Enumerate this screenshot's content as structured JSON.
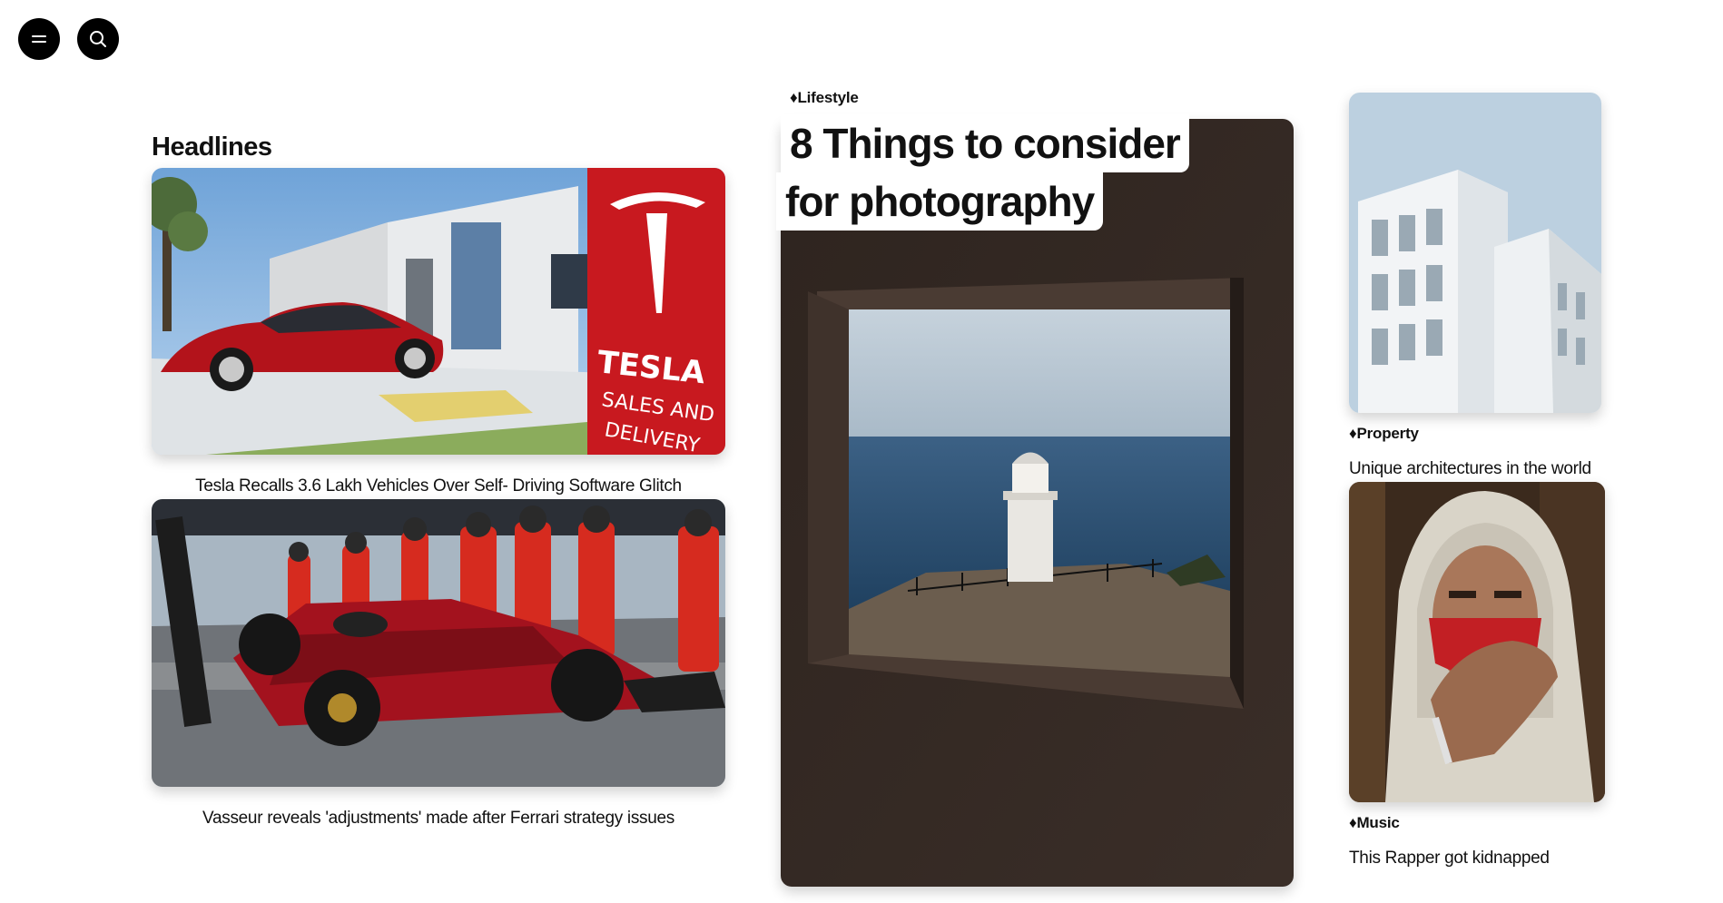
{
  "nav": {
    "menu_icon": "hamburger-menu-icon",
    "search_icon": "search-icon"
  },
  "headlines": {
    "title": "Headlines",
    "items": [
      {
        "caption": "Tesla Recalls 3.6 Lakh Vehicles Over Self- Driving Software Glitch",
        "image": "Red Tesla car parked in front of a Tesla sales and delivery building"
      },
      {
        "caption": "Vasseur reveals 'adjustments' made after Ferrari strategy issues",
        "image": "Ferrari Formula 1 car during a pit stop with crew in red suits"
      }
    ]
  },
  "feature": {
    "tag": "♦Lifestyle",
    "title_line1": "8 Things to consider",
    "title_line2": "for photography",
    "image": "Lighthouse by the sea seen through a stone window"
  },
  "side": [
    {
      "tag": "♦Property",
      "title": "Unique architectures in the world",
      "image": "White modern stacked apartment building against a blue sky"
    },
    {
      "tag": "♦Music",
      "title": "This Rapper got kidnapped",
      "image": "Man in a hooded jacket with red face mask and tattooed hand"
    }
  ],
  "colors": {
    "background": "#ffffff",
    "button": "#000000",
    "text": "#111111"
  }
}
